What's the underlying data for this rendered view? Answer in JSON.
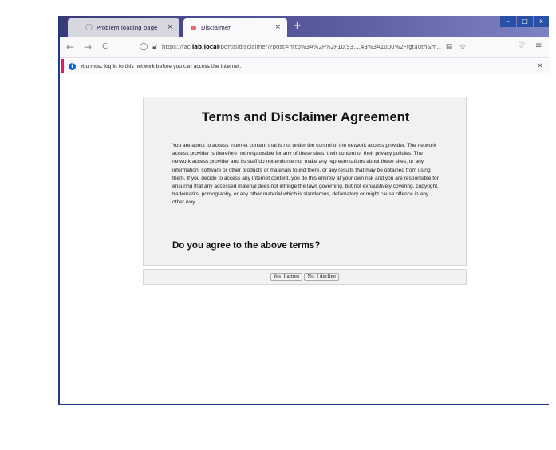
{
  "tabs": [
    {
      "title": "Problem loading page",
      "icon": "info-icon"
    },
    {
      "title": "Disclaimer",
      "icon": "fortinet-icon",
      "active": true
    }
  ],
  "tab_close_glyph": "×",
  "new_tab_glyph": "+",
  "window_controls": {
    "minimize": "–",
    "maximize": "□",
    "close": "x"
  },
  "nav": {
    "back": "←",
    "forward": "→",
    "reload": "C",
    "url_prefix": "https://fac.",
    "url_host": "lab.local",
    "url_rest": "/portal/disclaimer/?post=http%3A%2F%2F10.93.1.43%3A1000%2Ffgtauth&m..."
  },
  "notice": {
    "text": "You must log in to this network before you can access the Internet.",
    "close": "×"
  },
  "disclaimer": {
    "title": "Terms and Disclaimer Agreement",
    "body": "You are about to access Internet content that is not under the control of the network access provider. The network access provider is therefore not responsible for any of these sites, their content or their privacy policies. The network access provider and its staff do not endorse nor make any representations about these sites, or any information, software or other products or materials found there, or any results that may be obtained from using them. If you decide to access any Internet content, you do this entirely at your own risk and you are responsible for ensuring that any accessed material does not infringe the laws governing, but not exhaustively covering, copyright, trademarks, pornography, or any other material which is slanderous, defamatory or might cause offence in any other way.",
    "question": "Do you agree to the above terms?",
    "agree_label": "Yes, I agree",
    "decline_label": "No, I decline"
  },
  "colors": {
    "notice_accent": "#e01e5a",
    "info_blue": "#0061e0",
    "titlebar": "#4a4a8e"
  }
}
